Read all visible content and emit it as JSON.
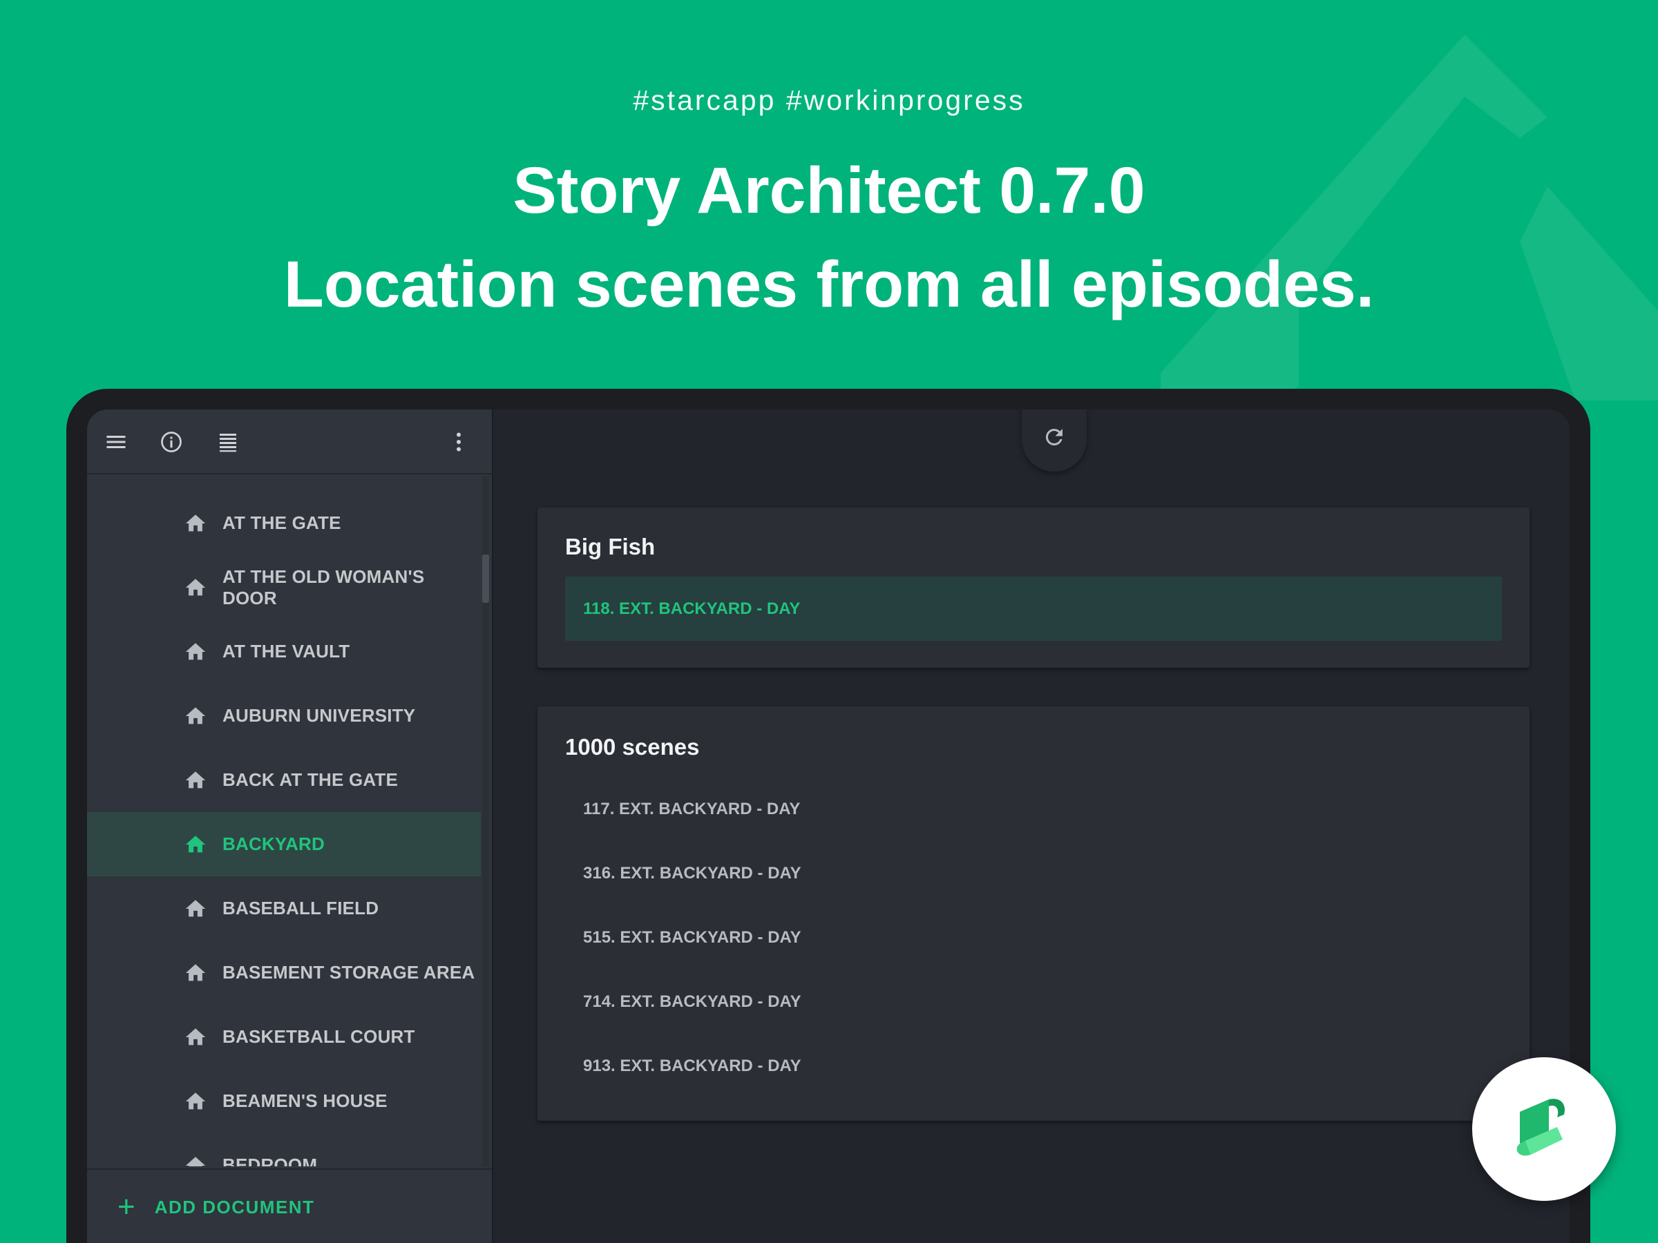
{
  "header": {
    "tags": "#starcapp  #workinprogress",
    "title_line1": "Story Architect 0.7.0",
    "title_line2": "Location scenes from all episodes."
  },
  "toolbar": {
    "icons": [
      "menu-icon",
      "info-icon",
      "text-list-icon",
      "more-vertical-icon"
    ]
  },
  "sidebar": {
    "items": [
      {
        "label": "AT THE GATE"
      },
      {
        "label": "AT THE OLD WOMAN'S DOOR"
      },
      {
        "label": "AT THE VAULT"
      },
      {
        "label": "AUBURN UNIVERSITY"
      },
      {
        "label": "BACK AT THE GATE"
      },
      {
        "label": "BACKYARD",
        "selected": true
      },
      {
        "label": "BASEBALL FIELD"
      },
      {
        "label": "BASEMENT STORAGE AREA"
      },
      {
        "label": "BASKETBALL COURT"
      },
      {
        "label": "BEAMEN'S HOUSE"
      },
      {
        "label": "BEDROOM"
      }
    ],
    "add_document": "ADD DOCUMENT"
  },
  "main": {
    "card1": {
      "title": "Big Fish",
      "scenes": [
        "118. EXT. BACKYARD - DAY"
      ]
    },
    "card2": {
      "title": "1000 scenes",
      "scenes": [
        "117. EXT. BACKYARD - DAY",
        "316. EXT. BACKYARD - DAY",
        "515. EXT. BACKYARD - DAY",
        "714. EXT. BACKYARD - DAY",
        "913. EXT. BACKYARD - DAY"
      ]
    }
  },
  "colors": {
    "background": "#00b37a",
    "accent": "#20c47e",
    "sidebar": "#30343c",
    "panel": "#22252c",
    "card": "#2b2e35"
  }
}
